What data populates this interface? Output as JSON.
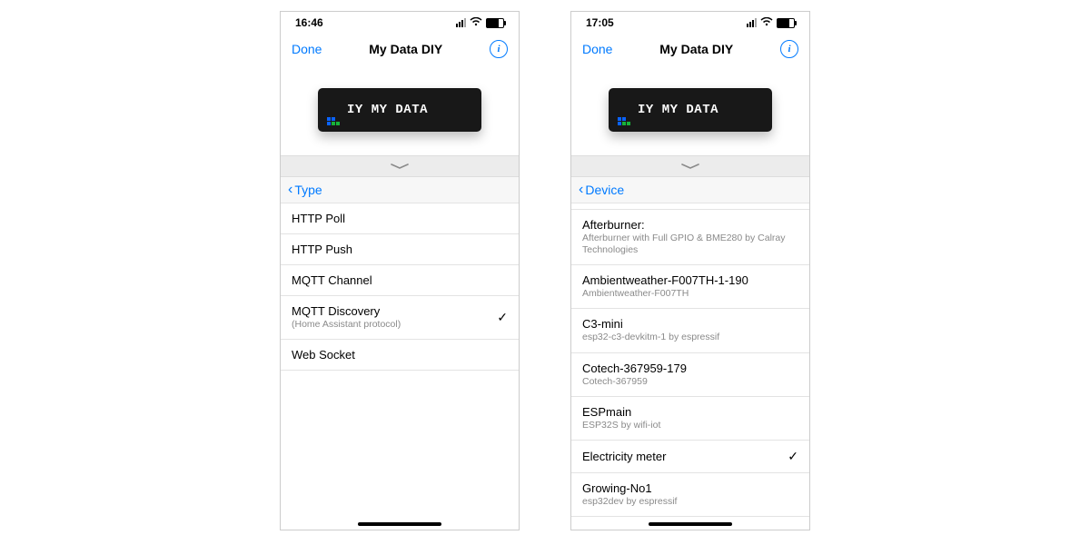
{
  "screens": [
    {
      "status_time": "16:46",
      "nav": {
        "done": "Done",
        "title": "My Data DIY"
      },
      "device_display_text": "IY MY DATA",
      "back_label": "Type",
      "items": [
        {
          "label": "HTTP Poll",
          "sub": "",
          "selected": false
        },
        {
          "label": "HTTP Push",
          "sub": "",
          "selected": false
        },
        {
          "label": "MQTT Channel",
          "sub": "",
          "selected": false
        },
        {
          "label": "MQTT Discovery",
          "sub": "(Home Assistant protocol)",
          "selected": true
        },
        {
          "label": "Web Socket",
          "sub": "",
          "selected": false
        }
      ]
    },
    {
      "status_time": "17:05",
      "nav": {
        "done": "Done",
        "title": "My Data DIY"
      },
      "device_display_text": "IY MY DATA",
      "back_label": "Device",
      "truncated_top": true,
      "items": [
        {
          "label": "Afterburner:",
          "sub": "Afterburner with Full GPIO & BME280 by Calray Technologies",
          "selected": false
        },
        {
          "label": "Ambientweather-F007TH-1-190",
          "sub": "Ambientweather-F007TH",
          "selected": false
        },
        {
          "label": "C3-mini",
          "sub": "esp32-c3-devkitm-1 by espressif",
          "selected": false
        },
        {
          "label": "Cotech-367959-179",
          "sub": "Cotech-367959",
          "selected": false
        },
        {
          "label": "ESPmain",
          "sub": "ESP32S by wifi-iot",
          "selected": false
        },
        {
          "label": "Electricity meter",
          "sub": "",
          "selected": true
        },
        {
          "label": "Growing-No1",
          "sub": "esp32dev by espressif",
          "selected": false
        }
      ]
    }
  ]
}
